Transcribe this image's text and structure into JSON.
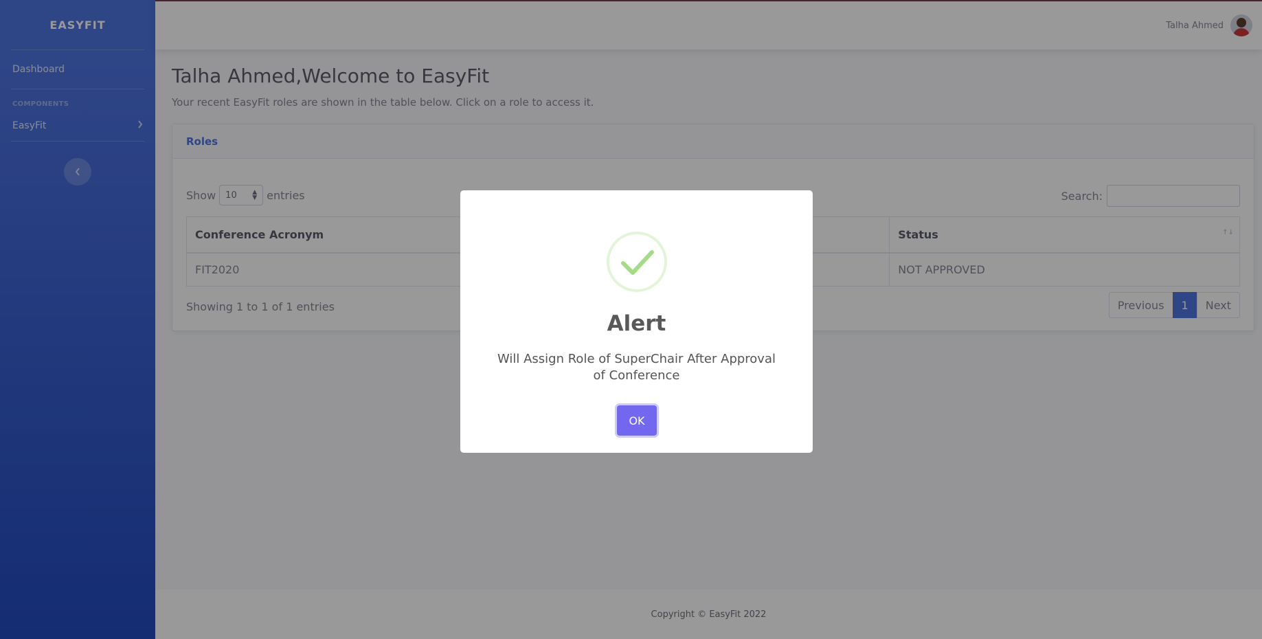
{
  "sidebar": {
    "brand": "EASYFIT",
    "dashboard": "Dashboard",
    "heading": "COMPONENTS",
    "easyfit": "EasyFit"
  },
  "topbar": {
    "user_name": "Talha Ahmed"
  },
  "main": {
    "title": "Talha Ahmed,Welcome to EasyFit",
    "description": "Your recent EasyFit roles are shown in the table below. Click on a role to access it.",
    "card_title": "Roles",
    "show_label": "Show",
    "entries_value": "10",
    "entries_label": "entries",
    "search_label": "Search:",
    "search_value": "",
    "columns": [
      "Conference Acronym",
      "",
      "Status"
    ],
    "rows": [
      [
        "FIT2020",
        "",
        "NOT APPROVED"
      ]
    ],
    "showing": "Showing 1 to 1 of 1 entries",
    "pagination": {
      "previous": "Previous",
      "current": "1",
      "next": "Next"
    }
  },
  "footer": {
    "copyright": "Copyright © EasyFit 2022"
  },
  "modal": {
    "icon": "success-check-icon",
    "title": "Alert",
    "text": "Will Assign Role of SuperChair After Approval of Conference",
    "ok_label": "OK",
    "accent_color": "#7367f0",
    "check_color": "#a5dc86"
  }
}
